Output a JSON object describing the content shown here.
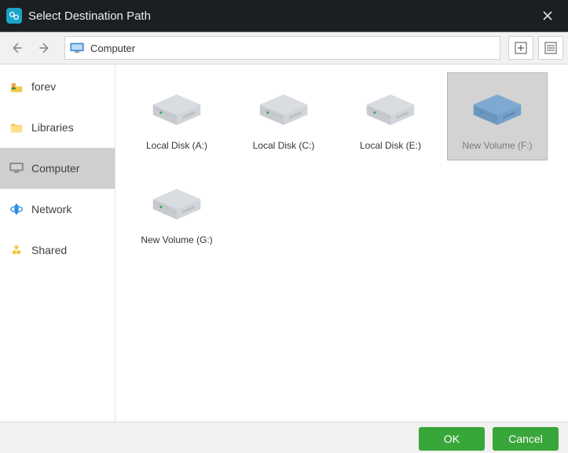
{
  "window": {
    "title": "Select Destination Path"
  },
  "nav": {
    "breadcrumb": "Computer"
  },
  "sidebar": {
    "items": [
      {
        "label": "forev",
        "icon": "user-icon",
        "selected": false
      },
      {
        "label": "Libraries",
        "icon": "folder-icon",
        "selected": false
      },
      {
        "label": "Computer",
        "icon": "computer-icon",
        "selected": true
      },
      {
        "label": "Network",
        "icon": "network-icon",
        "selected": false
      },
      {
        "label": "Shared",
        "icon": "shared-icon",
        "selected": false
      }
    ]
  },
  "drives": [
    {
      "label": "Local Disk (A:)",
      "accent": "#34a853",
      "body": "#d9dce0",
      "selected": false
    },
    {
      "label": "Local Disk (C:)",
      "accent": "#34a853",
      "body": "#d9dce0",
      "selected": false
    },
    {
      "label": "Local Disk (E:)",
      "accent": "#34a853",
      "body": "#d9dce0",
      "selected": false
    },
    {
      "label": "New Volume (F:)",
      "accent": "#5a8bbd",
      "body": "#7eaad2",
      "selected": true
    },
    {
      "label": "New Volume (G:)",
      "accent": "#34a853",
      "body": "#d9dce0",
      "selected": false
    }
  ],
  "footer": {
    "ok": "OK",
    "cancel": "Cancel"
  },
  "colors": {
    "titlebar": "#1c1f22",
    "primary": "#39a63a"
  }
}
